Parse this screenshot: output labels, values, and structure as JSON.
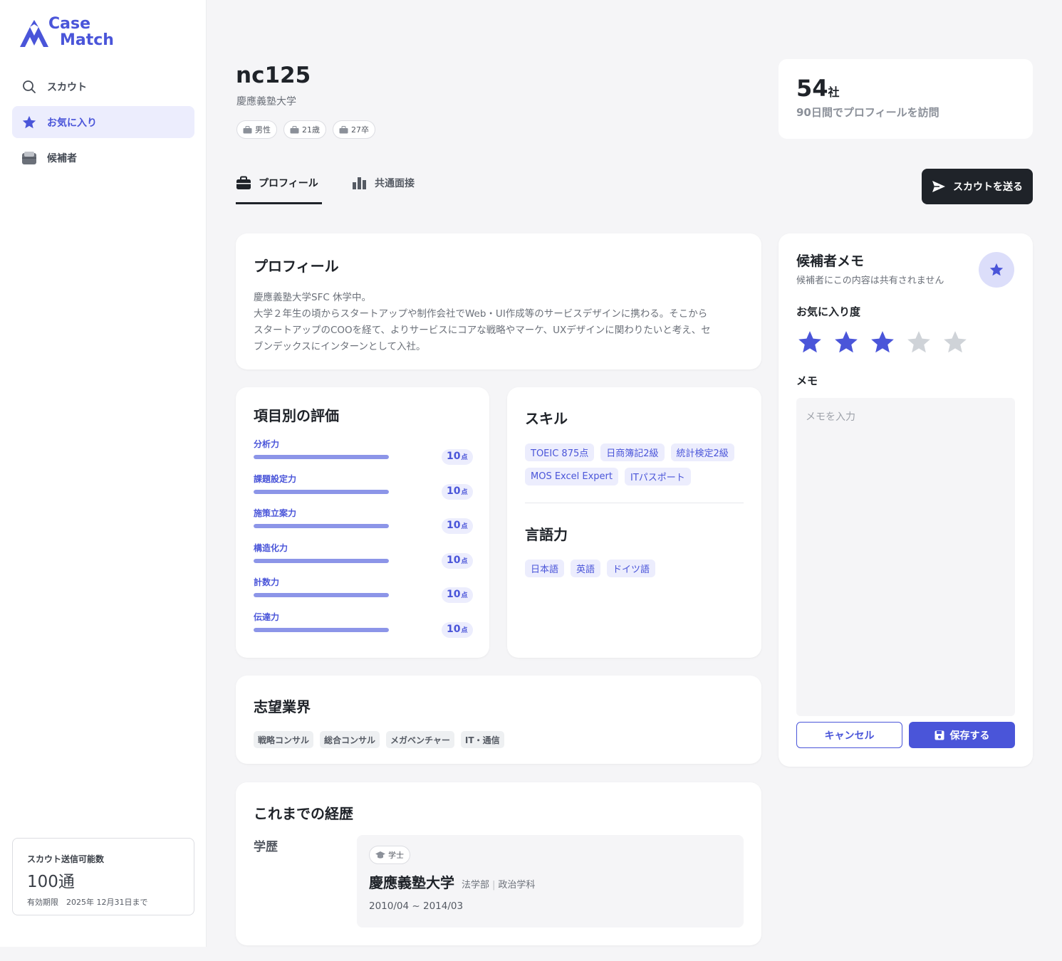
{
  "brand": {
    "line1": "Case",
    "line2": "Match",
    "color": "#4a55d9"
  },
  "sidebar": {
    "items": [
      {
        "label": "スカウト",
        "icon": "search-icon",
        "active": false
      },
      {
        "label": "お気に入り",
        "icon": "star-icon",
        "active": true
      },
      {
        "label": "候補者",
        "icon": "inbox-icon",
        "active": false
      }
    ],
    "credit": {
      "label": "スカウト送信可能数",
      "value": "100通",
      "expiry": "有効期限　2025年 12月31日まで"
    }
  },
  "candidate": {
    "id": "nc125",
    "university": "慶應義塾大学",
    "tags": [
      "男性",
      "21歳",
      "27卒"
    ]
  },
  "visits": {
    "count": "54",
    "unit": "社",
    "description": "90日間でプロフィールを訪問"
  },
  "tabs": [
    {
      "label": "プロフィール",
      "icon": "briefcase-icon",
      "active": true
    },
    {
      "label": "共通面接",
      "icon": "bar-chart-icon",
      "active": false
    }
  ],
  "scout_button": {
    "label": "スカウトを送る",
    "icon": "send-icon"
  },
  "profile": {
    "title": "プロフィール",
    "text": "慶應義塾大学SFC 休学中。\n大学２年生の頃からスタートアップや制作会社でWeb・UI作成等のサービスデザインに携わる。そこから\nスタートアップのCOOを経て、よりサービスにコアな戦略やマーケ、UXデザインに関わりたいと考え、セ\nブンデックスにインターンとして入社。"
  },
  "evaluation": {
    "title": "項目別の評価",
    "items": [
      {
        "label": "分析力",
        "score": "10",
        "unit": "点",
        "fill": 1.0
      },
      {
        "label": "課題設定力",
        "score": "10",
        "unit": "点",
        "fill": 1.0
      },
      {
        "label": "施策立案力",
        "score": "10",
        "unit": "点",
        "fill": 1.0
      },
      {
        "label": "構造化力",
        "score": "10",
        "unit": "点",
        "fill": 1.0
      },
      {
        "label": "計数力",
        "score": "10",
        "unit": "点",
        "fill": 1.0
      },
      {
        "label": "伝達力",
        "score": "10",
        "unit": "点",
        "fill": 1.0
      }
    ]
  },
  "skills": {
    "title": "スキル",
    "items": [
      "TOEIC 875点",
      "日商簿記2級",
      "統計検定2級",
      "MOS Excel Expert",
      "ITパスポート"
    ]
  },
  "languages": {
    "title": "言語力",
    "items": [
      "日本語",
      "英語",
      "ドイツ語"
    ]
  },
  "industries": {
    "title": "志望業界",
    "items": [
      "戦略コンサル",
      "総合コンサル",
      "メガベンチャー",
      "IT・通信"
    ]
  },
  "career": {
    "title": "これまでの経歴",
    "education_label": "学歴",
    "entry": {
      "degree": "学士",
      "school": "慶應義塾大学",
      "faculty": "法学部",
      "department": "政治学科",
      "period": "2010/04 ~ 2014/03"
    }
  },
  "memo": {
    "title": "候補者メモ",
    "subtitle": "候補者にこの内容は共有されません",
    "favorite_label": "お気に入り度",
    "rating": 3,
    "rating_max": 5,
    "memo_label": "メモ",
    "placeholder": "メモを入力",
    "cancel_label": "キャンセル",
    "save_label": "保存する"
  },
  "colors": {
    "accent": "#4a55d9",
    "dark": "#1f2329",
    "star_on": "#4a55d9",
    "star_off": "#cfd3d8"
  }
}
